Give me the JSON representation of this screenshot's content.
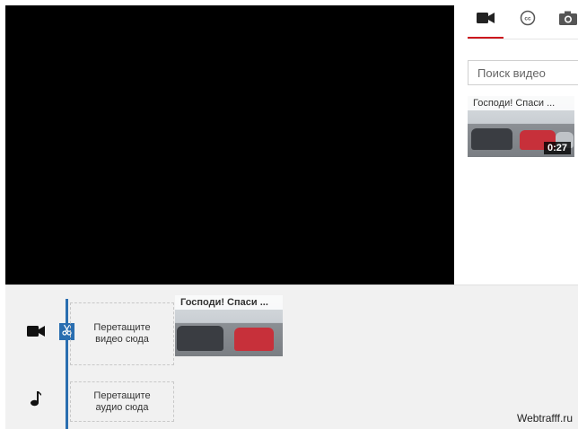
{
  "tabs": {
    "video_icon": "video-camera-icon",
    "cc_icon": "closed-captions-icon",
    "photo_icon": "camera-icon",
    "active": "video"
  },
  "search": {
    "placeholder": "Поиск видео",
    "value": ""
  },
  "results": [
    {
      "title": "Господи! Спаси ...",
      "duration": "0:27"
    }
  ],
  "timeline": {
    "video_track_icon": "video-camera-icon",
    "audio_track_icon": "music-note-icon",
    "video_drop_label": "Перетащите видео сюда",
    "audio_drop_label": "Перетащите аудио сюда",
    "clip_title": "Господи! Спаси ..."
  },
  "watermark": "Webtrafff.ru",
  "colors": {
    "accent": "#cc181e",
    "playhead": "#2a6eb0",
    "timeline_bg": "#f1f1f1"
  }
}
